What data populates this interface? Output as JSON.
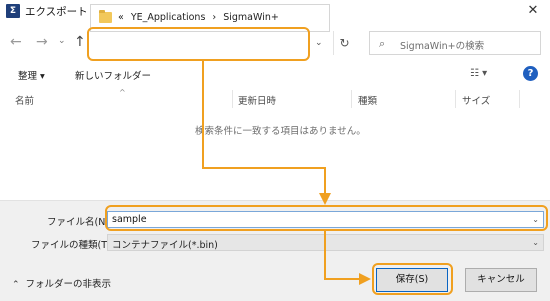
{
  "window": {
    "title": "エクスポート",
    "app_icon": "Σ",
    "close_glyph": "✕"
  },
  "nav": {
    "back_glyph": "←",
    "forward_glyph": "→",
    "recent_glyph": "⌄",
    "up_glyph": "↑",
    "refresh_glyph": "↻",
    "address_dropdown_glyph": "⌄",
    "breadcrumb": [
      "«",
      "YE_Applications",
      "›",
      "SigmaWin+"
    ]
  },
  "search": {
    "placeholder": "SigmaWin+の検索",
    "icon_glyph": "⌕"
  },
  "toolbar": {
    "organize_label": "整理 ▾",
    "new_folder_label": "新しいフォルダー",
    "view_glyph": "☷ ▾",
    "help_glyph": "?"
  },
  "columns": {
    "name": "名前",
    "modified": "更新日時",
    "type": "種類",
    "size": "サイズ",
    "sort_glyph": "^"
  },
  "list": {
    "empty_message": "検索条件に一致する項目はありません。"
  },
  "form": {
    "filename_label": "ファイル名(N):",
    "filename_value": "sample",
    "filetype_label": "ファイルの種類(T):",
    "filetype_value": "コンテナファイル(*.bin)",
    "dropdown_glyph": "⌄"
  },
  "footer": {
    "hide_folders_label": "フォルダーの非表示",
    "hide_folders_glyph": "⌃",
    "save_label": "保存(S)",
    "cancel_label": "キャンセル"
  },
  "colors": {
    "highlight": "#f0a020",
    "accent": "#0a64c2",
    "help": "#1f5fbf",
    "folder": "#f2c85b"
  }
}
